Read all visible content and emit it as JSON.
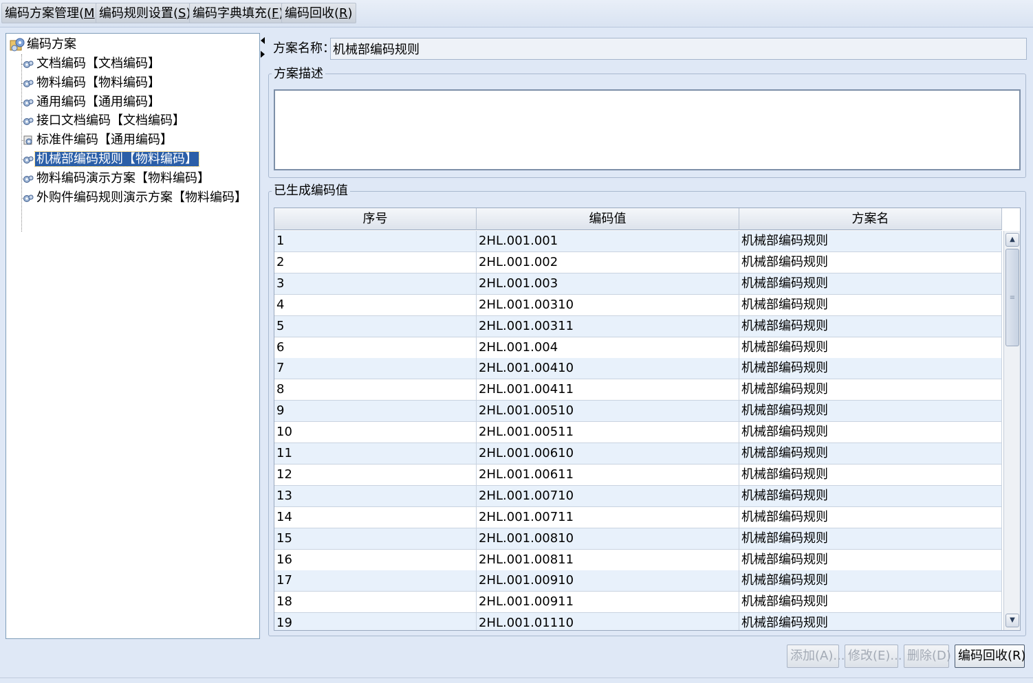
{
  "menu": [
    {
      "label": "编码方案管理",
      "key": "M"
    },
    {
      "label": "编码规则设置",
      "key": "S"
    },
    {
      "label": "编码字典填充",
      "key": "F"
    },
    {
      "label": "编码回收",
      "key": "R"
    }
  ],
  "tree": {
    "root": "编码方案",
    "items": [
      {
        "label": "文档编码【文档编码】",
        "icon": "gear-icon"
      },
      {
        "label": "物料编码【物料编码】",
        "icon": "gear-icon"
      },
      {
        "label": "通用编码【通用编码】",
        "icon": "gear-icon"
      },
      {
        "label": "接口文档编码【文档编码】",
        "icon": "gear-icon"
      },
      {
        "label": "标准件编码【通用编码】",
        "icon": "document-gear-icon"
      },
      {
        "label": "机械部编码规则【物料编码】",
        "icon": "gear-icon",
        "selected": true
      },
      {
        "label": "物料编码演示方案【物料编码】",
        "icon": "gear-icon"
      },
      {
        "label": "外购件编码规则演示方案【物料编码】",
        "icon": "gear-icon"
      }
    ]
  },
  "form": {
    "name_label": "方案名称：",
    "name_value": "机械部编码规则",
    "desc_group_title": "方案描述",
    "desc_value": "",
    "codes_group_title": "已生成编码值"
  },
  "table": {
    "columns": [
      "序号",
      "编码值",
      "方案名"
    ],
    "rows": [
      [
        "1",
        "2HL.001.001",
        "机械部编码规则"
      ],
      [
        "2",
        "2HL.001.002",
        "机械部编码规则"
      ],
      [
        "3",
        "2HL.001.003",
        "机械部编码规则"
      ],
      [
        "4",
        "2HL.001.00310",
        "机械部编码规则"
      ],
      [
        "5",
        "2HL.001.00311",
        "机械部编码规则"
      ],
      [
        "6",
        "2HL.001.004",
        "机械部编码规则"
      ],
      [
        "7",
        "2HL.001.00410",
        "机械部编码规则"
      ],
      [
        "8",
        "2HL.001.00411",
        "机械部编码规则"
      ],
      [
        "9",
        "2HL.001.00510",
        "机械部编码规则"
      ],
      [
        "10",
        "2HL.001.00511",
        "机械部编码规则"
      ],
      [
        "11",
        "2HL.001.00610",
        "机械部编码规则"
      ],
      [
        "12",
        "2HL.001.00611",
        "机械部编码规则"
      ],
      [
        "13",
        "2HL.001.00710",
        "机械部编码规则"
      ],
      [
        "14",
        "2HL.001.00711",
        "机械部编码规则"
      ],
      [
        "15",
        "2HL.001.00810",
        "机械部编码规则"
      ],
      [
        "16",
        "2HL.001.00811",
        "机械部编码规则"
      ],
      [
        "17",
        "2HL.001.00910",
        "机械部编码规则"
      ],
      [
        "18",
        "2HL.001.00911",
        "机械部编码规则"
      ],
      [
        "19",
        "2HL.001.01110",
        "机械部编码规则"
      ]
    ]
  },
  "buttons": {
    "add": "添加(A)...",
    "edit": "修改(E)...",
    "delete": "删除(D)",
    "recycle": "编码回收(R)"
  }
}
